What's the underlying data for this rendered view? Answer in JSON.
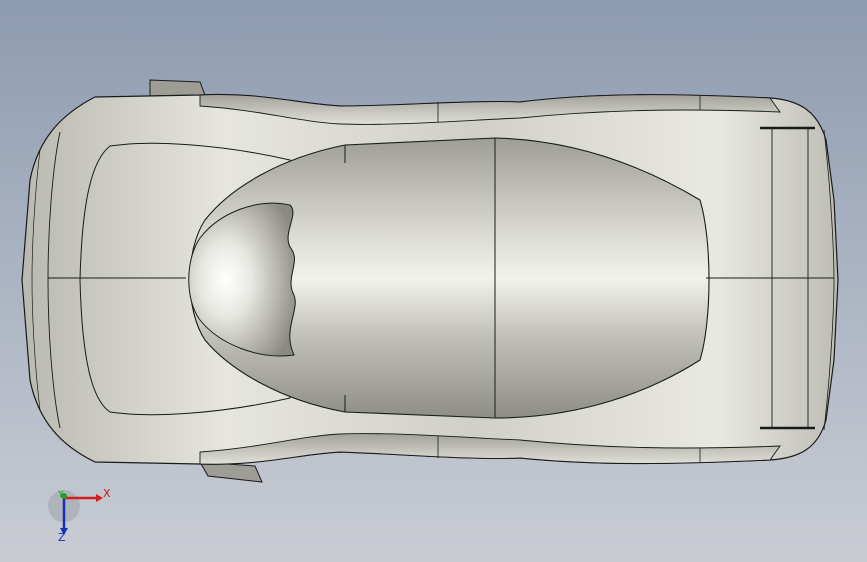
{
  "viewport": {
    "background_top": "#8d9bb0",
    "background_bottom": "#c9ccd3"
  },
  "model": {
    "body_color": "#d7d7d0",
    "edge_color": "#1a1a1a",
    "view": "top"
  },
  "triad": {
    "x_label": "X",
    "y_label": "Y",
    "z_label": "Z",
    "x_color": "#d42020",
    "y_color": "#1ea21e",
    "z_color": "#1a2fb5"
  }
}
